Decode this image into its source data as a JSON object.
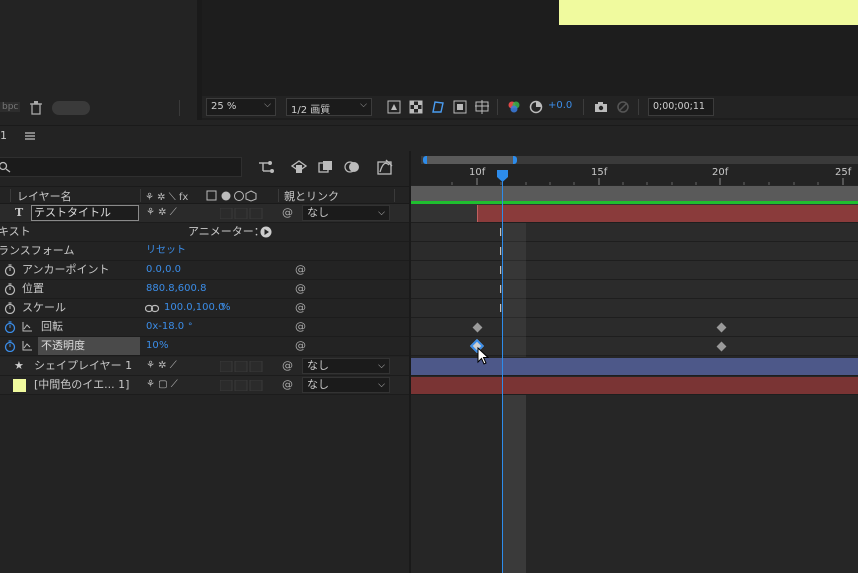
{
  "viewer": {
    "left_panel_bpc": "bpc",
    "zoom": "25 %",
    "resolution": "1/2 画質",
    "exposure": "+0.0",
    "timecode": "0;00;00;11"
  },
  "timeline": {
    "panel_title": "1",
    "search_placeholder": ""
  },
  "columns": {
    "layer_name": "レイヤー名",
    "parent_link": "親とリンク"
  },
  "ruler": {
    "ticks": [
      "10f",
      "15f",
      "20f",
      "25f"
    ]
  },
  "rows": {
    "text_layer": {
      "name": "テストタイトル",
      "parent": "なし"
    },
    "text_group": {
      "label": "キスト",
      "animator": "アニメーター："
    },
    "transform": {
      "label": "ランスフォーム",
      "reset": "リセット"
    },
    "anchor": {
      "label": "アンカーポイント",
      "value": "0.0,0.0"
    },
    "position": {
      "label": "位置",
      "value": "880.8,600.8"
    },
    "scale": {
      "label": "スケール",
      "value": "100.0,100.0",
      "unit": "%"
    },
    "rotation": {
      "label": "回転",
      "value": "0x-18.0",
      "unit": "°"
    },
    "opacity": {
      "label": "不透明度",
      "value": "10",
      "unit": "%"
    },
    "shape_layer": {
      "name": "シェイプレイヤー 1",
      "parent": "なし"
    },
    "solid_layer": {
      "name": "[中間色のイエ... 1]",
      "parent": "なし"
    }
  },
  "colors": {
    "accent": "#2d8ceb",
    "text_bar": "#8a3b3b",
    "shape_bar": "#4d5889",
    "solid_bar": "#7a3434",
    "solid_swatch": "#f0fa9e"
  }
}
